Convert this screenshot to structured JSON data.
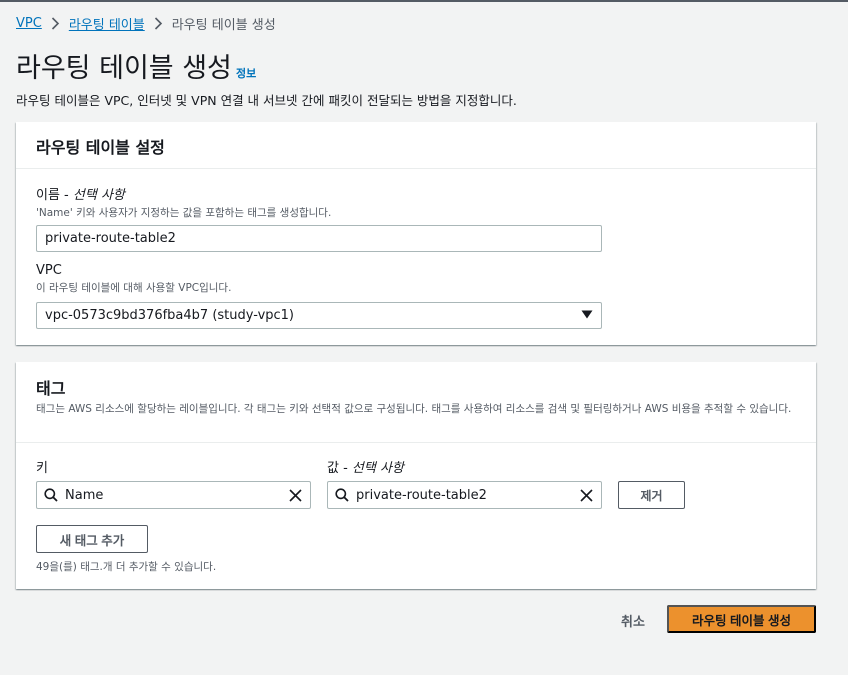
{
  "breadcrumb": {
    "items": [
      "VPC",
      "라우팅 테이블"
    ],
    "current": "라우팅 테이블 생성"
  },
  "page": {
    "title": "라우팅 테이블 생성",
    "info_label": "정보",
    "description": "라우팅 테이블은 VPC, 인터넷 및 VPN 연결 내 서브넷 간에 패킷이 전달되는 방법을 지정합니다."
  },
  "settings": {
    "title": "라우팅 테이블 설정",
    "name_label": "이름 - ",
    "name_optional": "선택 사항",
    "name_desc": "'Name' 키와 사용자가 지정하는 값을 포함하는 태그를 생성합니다.",
    "name_value": "private-route-table2",
    "vpc_label": "VPC",
    "vpc_desc": "이 라우팅 테이블에 대해 사용할 VPC입니다.",
    "vpc_value": "vpc-0573c9bd376fba4b7 (study-vpc1)"
  },
  "tags": {
    "title": "태그",
    "description": "태그는 AWS 리소스에 할당하는 레이블입니다. 각 태그는 키와 선택적 값으로 구성됩니다. 태그를 사용하여 리소스를 검색 및 필터링하거나 AWS 비용을 추적할 수 있습니다.",
    "key_label": "키",
    "value_label": "값 - ",
    "value_optional": "선택 사항",
    "key_value": "Name",
    "value_value": "private-route-table2",
    "remove_label": "제거",
    "add_label": "새 태그 추가",
    "remaining_text": "49을(를) 태그.개 더 추가할 수 있습니다."
  },
  "footer": {
    "cancel_label": "취소",
    "create_label": "라우팅 테이블 생성"
  },
  "colors": {
    "primary_button": "#ec912d",
    "link": "#0073bb",
    "background": "#f2f3f3"
  }
}
